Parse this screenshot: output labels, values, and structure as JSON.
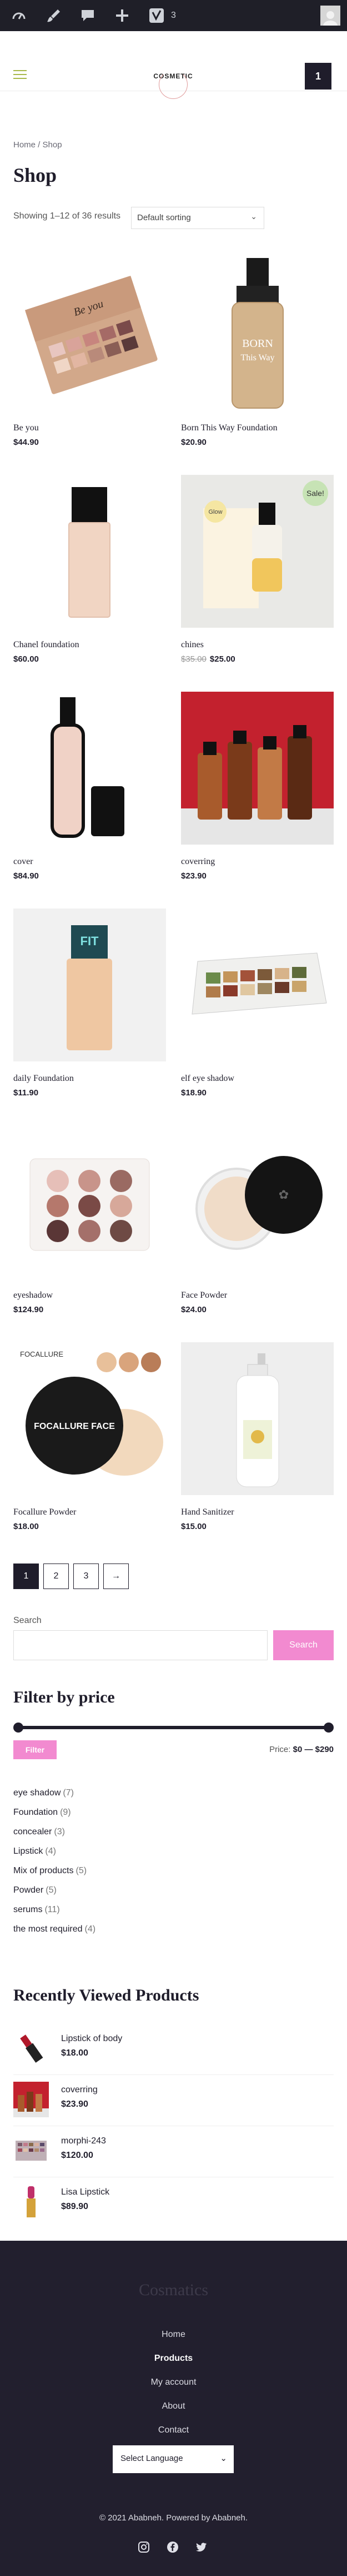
{
  "admin_bar": {
    "comments_count": "3"
  },
  "header": {
    "logo_text": "COSMETIC",
    "cart_count": "1"
  },
  "breadcrumb": "Home / Shop",
  "page_title": "Shop",
  "result_count": "Showing 1–12 of 36 results",
  "orderby": {
    "selected": "Default sorting"
  },
  "products": [
    {
      "name": "Be you",
      "price": "$44.90"
    },
    {
      "name": "Born This Way Foundation",
      "price": "$20.90"
    },
    {
      "name": "Chanel foundation",
      "price": "$60.00"
    },
    {
      "name": "chines",
      "old_price": "$35.00",
      "price": "$25.00",
      "badge": "Sale!"
    },
    {
      "name": "cover",
      "price": "$84.90"
    },
    {
      "name": "coverring",
      "price": "$23.90"
    },
    {
      "name": "daily Foundation",
      "price": "$11.90"
    },
    {
      "name": "elf eye shadow",
      "price": "$18.90"
    },
    {
      "name": "eyeshadow",
      "price": "$124.90"
    },
    {
      "name": "Face Powder",
      "price": "$24.00"
    },
    {
      "name": "Focallure Powder",
      "price": "$18.00"
    },
    {
      "name": "Hand Sanitizer",
      "price": "$15.00"
    }
  ],
  "pagination": {
    "pages": [
      "1",
      "2",
      "3"
    ],
    "next": "→",
    "current": "1"
  },
  "search": {
    "label": "Search",
    "placeholder": "",
    "button": "Search"
  },
  "filter_price": {
    "title": "Filter by price",
    "button": "Filter",
    "price_prefix": "Price:",
    "price_range": "$0 — $290",
    "min_fraction": 0,
    "max_fraction": 1
  },
  "categories": [
    {
      "name": "eye shadow",
      "count": "(7)"
    },
    {
      "name": "Foundation",
      "count": "(9)"
    },
    {
      "name": "concealer",
      "count": "(3)"
    },
    {
      "name": "Lipstick",
      "count": "(4)"
    },
    {
      "name": "Mix of products",
      "count": "(5)"
    },
    {
      "name": "Powder",
      "count": "(5)"
    },
    {
      "name": "serums",
      "count": "(11)"
    },
    {
      "name": "the most required",
      "count": "(4)"
    }
  ],
  "recently_viewed": {
    "title": "Recently Viewed Products",
    "items": [
      {
        "name": "Lipstick of body",
        "price": "$18.00"
      },
      {
        "name": "coverring",
        "price": "$23.90"
      },
      {
        "name": "morphi-243",
        "price": "$120.00"
      },
      {
        "name": "Lisa Lipstick",
        "price": "$89.90"
      }
    ]
  },
  "footer": {
    "title": "Cosmatics",
    "nav": [
      "Home",
      "Products",
      "My account",
      "About",
      "Contact"
    ],
    "active_nav": "Products",
    "language_select": "Select Language",
    "copyright": "© 2021 Ababneh. Powered by Ababneh."
  },
  "colors": {
    "dark": "#1f1d2b",
    "accent_pink": "#f28ad0",
    "footer_bg": "#221f2e"
  }
}
